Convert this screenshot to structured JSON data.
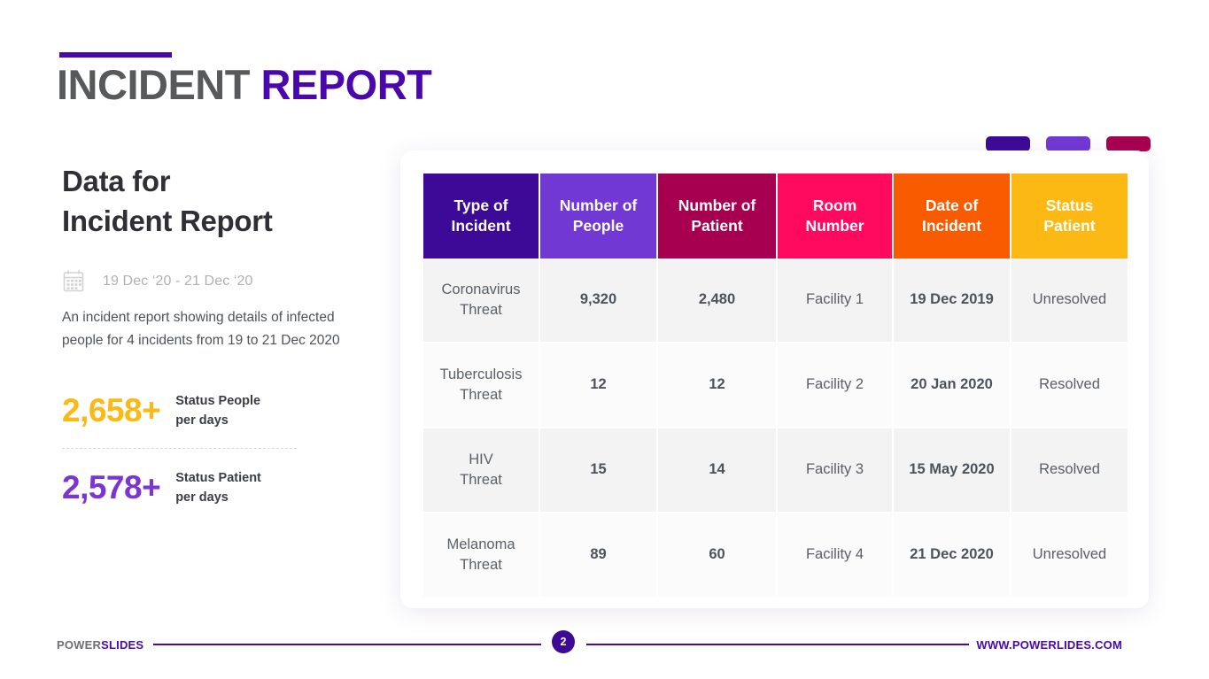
{
  "title": {
    "part1": "INCIDENT",
    "part2": "REPORT",
    "part1_color": "#58595b",
    "part2_color": "#4a08ac"
  },
  "left": {
    "heading_line1": "Data for",
    "heading_line2": "Incident Report",
    "calendar_icon": "calendar-icon",
    "date_range": "19 Dec ‘20 - 21 Dec ‘20",
    "description": "An incident report showing details of infected people for 4 incidents from 19 to 21 Dec 2020",
    "stats": [
      {
        "value": "2,658+",
        "label_line1": "Status People",
        "label_line2": "per days",
        "color": "#fcb813"
      },
      {
        "value": "2,578+",
        "label_line1": "Status Patient",
        "label_line2": "per days",
        "color": "#7b35d2"
      }
    ]
  },
  "pills": [
    {
      "name": "pill-indigo",
      "color": "#3c0a96"
    },
    {
      "name": "pill-purple",
      "color": "#7238d4"
    },
    {
      "name": "pill-magenta",
      "color": "#a80050"
    }
  ],
  "table": {
    "headers": [
      {
        "line1": "Type of",
        "line2": "Incident",
        "color": "#3c0a96"
      },
      {
        "line1": "Number of",
        "line2": "People",
        "color": "#7238d4"
      },
      {
        "line1": "Number of",
        "line2": "Patient",
        "color": "#a80050"
      },
      {
        "line1": "Room",
        "line2": "Number",
        "color": "#ff0a5e"
      },
      {
        "line1": "Date of",
        "line2": "Incident",
        "color": "#f95c00"
      },
      {
        "line1": "Status",
        "line2": "Patient",
        "color": "#fcb813"
      }
    ],
    "rows": [
      {
        "incident_line1": "Coronavirus",
        "incident_line2": "Threat",
        "number_of_people": "9,320",
        "number_of_patient": "2,480",
        "room_number": "Facility 1",
        "date_of_incident": "19 Dec 2019",
        "status_patient": "Unresolved"
      },
      {
        "incident_line1": "Tuberculosis",
        "incident_line2": "Threat",
        "number_of_people": "12",
        "number_of_patient": "12",
        "room_number": "Facility 2",
        "date_of_incident": "20 Jan 2020",
        "status_patient": "Resolved"
      },
      {
        "incident_line1": "HIV",
        "incident_line2": "Threat",
        "number_of_people": "15",
        "number_of_patient": "14",
        "room_number": "Facility 3",
        "date_of_incident": "15 May 2020",
        "status_patient": "Resolved"
      },
      {
        "incident_line1": "Melanoma",
        "incident_line2": "Threat",
        "number_of_people": "89",
        "number_of_patient": "60",
        "room_number": "Facility 4",
        "date_of_incident": "21 Dec 2020",
        "status_patient": "Unresolved"
      }
    ]
  },
  "footer": {
    "brand_part1": "POWER",
    "brand_part2": "SLIDES",
    "page_number": "2",
    "url": "WWW.POWERLIDES.COM"
  }
}
